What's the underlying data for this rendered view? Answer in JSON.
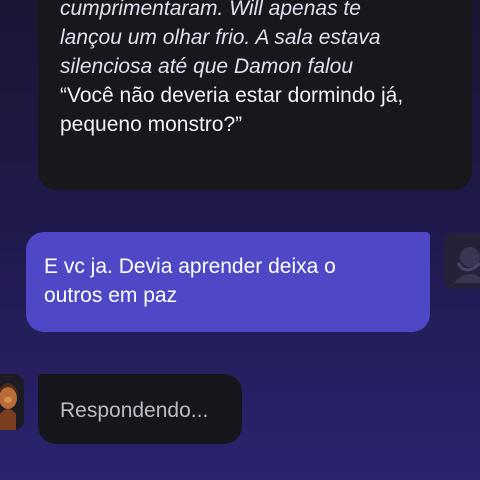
{
  "chat": {
    "ai_message": {
      "narration_lines": [
        "cumprimentaram. Will apenas te",
        "lançou um olhar frio. A sala estava",
        "silenciosa até que Damon falou"
      ],
      "dialogue_lines": [
        "“Você não deveria estar dormindo já,",
        "pequeno monstro?”"
      ]
    },
    "user_message": {
      "lines": [
        "E vc ja. Devia aprender deixa o",
        "outros em paz"
      ]
    },
    "typing_indicator": {
      "label": "Respondendo..."
    }
  },
  "theme": {
    "background_top": "#1a1634",
    "background_bottom": "#2a2370",
    "ai_bubble": "#18171c",
    "user_bubble": "#4e48c6"
  },
  "icons": {
    "user_avatar": "user-avatar-icon",
    "character_avatar": "character-avatar-icon"
  }
}
